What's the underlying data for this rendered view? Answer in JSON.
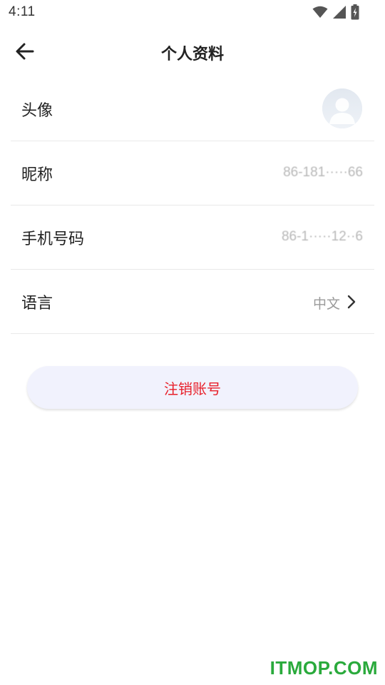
{
  "status_bar": {
    "time": "4:11",
    "icons": [
      "wifi-icon",
      "cell-signal-icon",
      "battery-charging-icon"
    ]
  },
  "app_bar": {
    "back_icon": "arrow-left-icon",
    "title": "个人资料"
  },
  "profile": {
    "rows": [
      {
        "key": "avatar",
        "label": "头像",
        "value": ""
      },
      {
        "key": "nickname",
        "label": "昵称",
        "value": "86-181·····66"
      },
      {
        "key": "phone",
        "label": "手机号码",
        "value": "86-1·····12··6"
      },
      {
        "key": "language",
        "label": "语言",
        "value": "中文"
      }
    ]
  },
  "actions": {
    "deactivate_label": "注销账号",
    "deactivate_color": "#e8202a"
  },
  "watermark": "ITMOP.COM",
  "colors": {
    "background": "#ffffff",
    "button_bg": "#f1f2fd",
    "divider": "#e9e9e9",
    "value_text": "#9a9a9a",
    "watermark": "#2aaa3c"
  }
}
